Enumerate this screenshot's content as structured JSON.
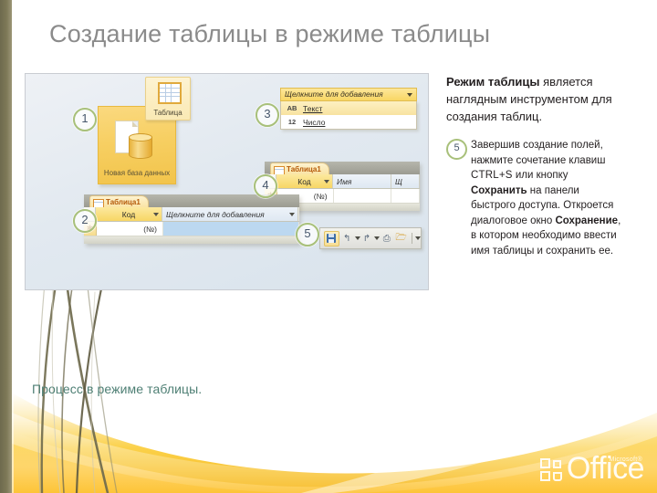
{
  "slide": {
    "title": "Создание таблицы в режиме таблицы",
    "caption": "Процесс в режиме таблицы."
  },
  "body": {
    "lead_bold": "Режим таблицы",
    "lead_rest": " является наглядным инструментом для создания таблиц.",
    "bullet": {
      "number": "5",
      "part1": "Завершив создание полей, нажмите сочетание клавиш ",
      "kbd": "CTRL+S",
      "part2": " или кнопку ",
      "bold1": "Сохранить",
      "part3": " на панели быстрого доступа. Откроется диалоговое окно ",
      "bold2": "Сохранение",
      "part4": ", в котором необходимо ввести имя таблицы и сохранить ее."
    }
  },
  "screenshot": {
    "callouts": [
      "1",
      "2",
      "3",
      "4",
      "5"
    ],
    "new_db_tile": {
      "label": "Новая база данных"
    },
    "ribbon_button": {
      "label": "Таблица",
      "icon": "table-grid-icon"
    },
    "dropdown": {
      "header": "Щелкните для добавления",
      "items": [
        {
          "icon": "AB",
          "label": "Текст"
        },
        {
          "icon": "12",
          "label": "Число"
        }
      ]
    },
    "datasheet_2": {
      "tab_label": "Таблица1",
      "columns": [
        "Код",
        "Щелкните для добавления"
      ],
      "row_value": "(№)",
      "new_row_marker": "✱"
    },
    "datasheet_4": {
      "tab_label": "Таблица1",
      "columns": [
        "Код",
        "Имя",
        "Щ"
      ],
      "row_value": "(№)",
      "new_row_marker": "✱"
    },
    "quick_access_toolbar": {
      "items": [
        "save-icon",
        "undo-icon",
        "redo-icon",
        "print-icon",
        "open-icon",
        "customize-icon"
      ]
    }
  },
  "logo": {
    "word": "Office",
    "tm": "Microsoft®"
  },
  "colors": {
    "title_gray": "#8b8b8b",
    "caption_teal": "#4e7f74",
    "accent_gold": "#f7cf62",
    "callout_ring": "#a8c07a",
    "left_strip": "#7d7857"
  }
}
